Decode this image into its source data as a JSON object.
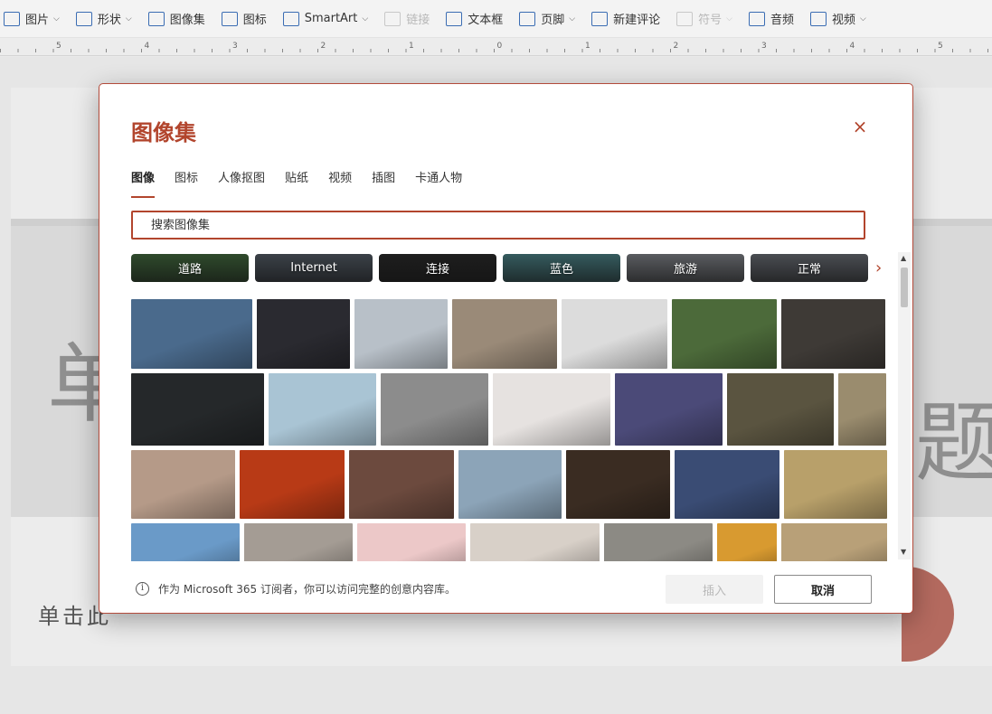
{
  "ribbon": {
    "items": [
      {
        "label": "图片",
        "icon": "picture-icon",
        "chevron": true,
        "disabled": false
      },
      {
        "label": "形状",
        "icon": "shapes-icon",
        "chevron": true,
        "disabled": false
      },
      {
        "label": "图像集",
        "icon": "image-set-icon",
        "chevron": false,
        "disabled": false
      },
      {
        "label": "图标",
        "icon": "icons-icon",
        "chevron": false,
        "disabled": false
      },
      {
        "label": "SmartArt",
        "icon": "smartart-icon",
        "chevron": true,
        "disabled": false
      },
      {
        "label": "链接",
        "icon": "link-icon",
        "chevron": false,
        "disabled": true
      },
      {
        "label": "文本框",
        "icon": "textbox-icon",
        "chevron": false,
        "disabled": false
      },
      {
        "label": "页脚",
        "icon": "footer-icon",
        "chevron": true,
        "disabled": false
      },
      {
        "label": "新建评论",
        "icon": "comment-icon",
        "chevron": false,
        "disabled": false
      },
      {
        "label": "符号",
        "icon": "omega-icon",
        "chevron": true,
        "disabled": true
      },
      {
        "label": "音频",
        "icon": "audio-icon",
        "chevron": false,
        "disabled": false
      },
      {
        "label": "视频",
        "icon": "video-icon",
        "chevron": true,
        "disabled": false
      }
    ]
  },
  "ruler": {
    "numbers": [
      "5",
      "4",
      "3",
      "2",
      "1",
      "0",
      "1",
      "2",
      "3",
      "4",
      "5"
    ]
  },
  "slide": {
    "big_left": "单",
    "big_right": "题",
    "subtitle": "单击此"
  },
  "dialog": {
    "title": "图像集",
    "close": "×",
    "tabs": [
      "图像",
      "图标",
      "人像抠图",
      "贴纸",
      "视频",
      "插图",
      "卡通人物"
    ],
    "active_tab": "图像",
    "search": {
      "placeholder": "搜索图像集",
      "value": ""
    },
    "chips": [
      {
        "label": "道路",
        "color": "#2f4a2c"
      },
      {
        "label": "Internet",
        "color": "#3b4148"
      },
      {
        "label": "连接",
        "color": "#1e1e1e"
      },
      {
        "label": "蓝色",
        "color": "#355b5e"
      },
      {
        "label": "旅游",
        "color": "#5a5c60"
      },
      {
        "label": "正常",
        "color": "#4a4d52"
      }
    ],
    "chip_next": "›",
    "footer_info": "作为 Microsoft 365 订阅者，你可以访问完整的创意内容库。",
    "insert_label": "插入",
    "cancel_label": "取消",
    "scroll_up": "▲",
    "scroll_down": "▼"
  },
  "gallery": {
    "rows": [
      [
        {
          "name": "frozen-landscape-photo",
          "color": "#4a6a8c"
        },
        {
          "name": "ballet-dancers-photo",
          "color": "#2a2a30"
        },
        {
          "name": "surreal-monument-photo",
          "color": "#b8c0c8"
        },
        {
          "name": "businesswoman-photo",
          "color": "#9a8a78"
        },
        {
          "name": "white-texture-photo",
          "color": "#dcdcdc"
        },
        {
          "name": "plant-shop-photo",
          "color": "#4c6a3a"
        },
        {
          "name": "barber-photo",
          "color": "#3e3a36"
        }
      ],
      [
        {
          "name": "dark-swirl-photo",
          "color": "#25282a"
        },
        {
          "name": "beach-legs-photo",
          "color": "#a9c4d4"
        },
        {
          "name": "spiral-staircase-photo",
          "color": "#8c8c8c"
        },
        {
          "name": "lipsticks-photo",
          "color": "#e6e2e0"
        },
        {
          "name": "concert-crowd-photo",
          "color": "#4b4a78"
        },
        {
          "name": "wine-glasses-photo",
          "color": "#5a5440"
        },
        {
          "name": "hill-town-photo",
          "color": "#9a8c6e"
        }
      ],
      [
        {
          "name": "man-with-cat-photo",
          "color": "#b59a88"
        },
        {
          "name": "orange-smoke-photo",
          "color": "#b83a16"
        },
        {
          "name": "bokeh-lights-photo",
          "color": "#6c4a3e"
        },
        {
          "name": "boat-family-photo",
          "color": "#8ca4b8"
        },
        {
          "name": "basketball-player-photo",
          "color": "#3a2c22"
        },
        {
          "name": "blueberries-photo",
          "color": "#3a4c74"
        },
        {
          "name": "olive-branch-photo",
          "color": "#b8a06a"
        }
      ],
      [
        {
          "name": "golden-gate-photo",
          "color": "#6a9ac8"
        },
        {
          "name": "city-couple-photo",
          "color": "#a49c94"
        },
        {
          "name": "confetti-photo",
          "color": "#ecc8c8"
        },
        {
          "name": "child-bed-photo",
          "color": "#d8d0c8"
        },
        {
          "name": "wood-grain-photo",
          "color": "#8c8a84"
        },
        {
          "name": "honey-photo",
          "color": "#d89a30"
        },
        {
          "name": "yellow-room-photo",
          "color": "#b8a078"
        }
      ]
    ]
  }
}
